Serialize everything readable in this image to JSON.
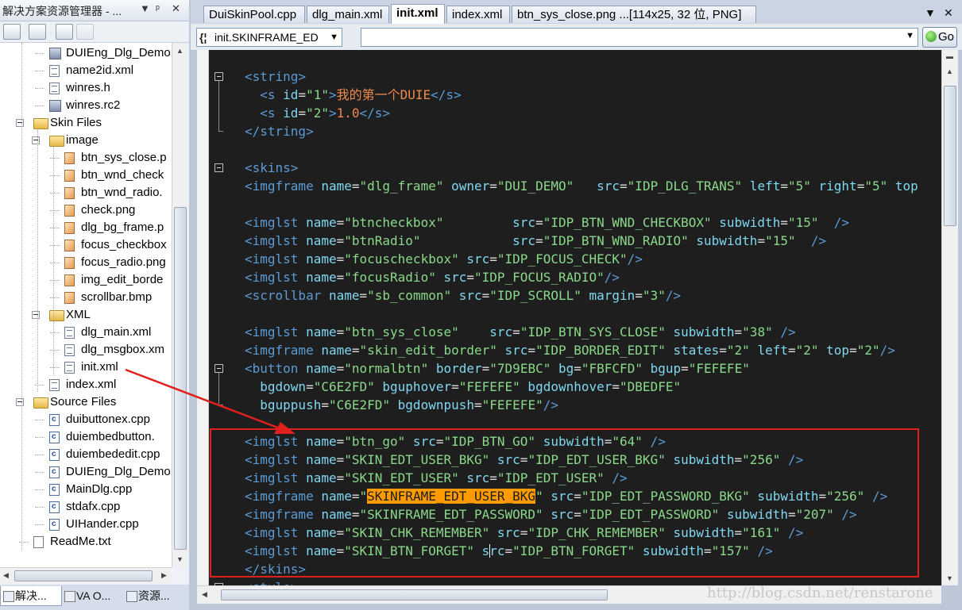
{
  "solution_explorer": {
    "title": "解决方案资源管理器 - ...",
    "title_buttons": [
      "▼",
      "ᵖ",
      "✕"
    ],
    "tree": [
      {
        "label": "DUIEng_Dlg_Demo",
        "icon": "rc",
        "level": 3
      },
      {
        "label": "name2id.xml",
        "icon": "file",
        "level": 3
      },
      {
        "label": "winres.h",
        "icon": "file",
        "level": 3
      },
      {
        "label": "winres.rc2",
        "icon": "rc",
        "level": 3
      },
      {
        "label": "Skin Files",
        "icon": "folder",
        "level": 2,
        "expandable": true
      },
      {
        "label": "image",
        "icon": "folder",
        "level": 3,
        "expandable": true
      },
      {
        "label": "btn_sys_close.p",
        "icon": "img",
        "level": 4
      },
      {
        "label": "btn_wnd_check",
        "icon": "img",
        "level": 4
      },
      {
        "label": "btn_wnd_radio.",
        "icon": "img",
        "level": 4
      },
      {
        "label": "check.png",
        "icon": "img",
        "level": 4
      },
      {
        "label": "dlg_bg_frame.p",
        "icon": "img",
        "level": 4
      },
      {
        "label": "focus_checkbox",
        "icon": "img",
        "level": 4
      },
      {
        "label": "focus_radio.png",
        "icon": "img",
        "level": 4
      },
      {
        "label": "img_edit_borde",
        "icon": "img",
        "level": 4
      },
      {
        "label": "scrollbar.bmp",
        "icon": "img",
        "level": 4
      },
      {
        "label": "XML",
        "icon": "folder",
        "level": 3,
        "expandable": true
      },
      {
        "label": "dlg_main.xml",
        "icon": "file",
        "level": 4
      },
      {
        "label": "dlg_msgbox.xm",
        "icon": "file",
        "level": 4
      },
      {
        "label": "init.xml",
        "icon": "file",
        "level": 4
      },
      {
        "label": "index.xml",
        "icon": "file",
        "level": 3
      },
      {
        "label": "Source Files",
        "icon": "folder",
        "level": 2,
        "expandable": true
      },
      {
        "label": "duibuttonex.cpp",
        "icon": "cpp",
        "level": 3
      },
      {
        "label": "duiembedbutton.",
        "icon": "cpp",
        "level": 3
      },
      {
        "label": "duiembededit.cpp",
        "icon": "cpp",
        "level": 3
      },
      {
        "label": "DUIEng_Dlg_Demo",
        "icon": "cpp",
        "level": 3
      },
      {
        "label": "MainDlg.cpp",
        "icon": "cpp",
        "level": 3
      },
      {
        "label": "stdafx.cpp",
        "icon": "cpp",
        "level": 3
      },
      {
        "label": "UIHander.cpp",
        "icon": "cpp",
        "level": 3
      },
      {
        "label": "ReadMe.txt",
        "icon": "txt",
        "level": 2
      }
    ],
    "bottom_tabs": [
      "解决...",
      "VA O...",
      "资源..."
    ]
  },
  "editor": {
    "tabs": [
      {
        "label": "DuiSkinPool.cpp",
        "active": false
      },
      {
        "label": "dlg_main.xml",
        "active": false
      },
      {
        "label": "init.xml",
        "active": true
      },
      {
        "label": "index.xml",
        "active": false
      },
      {
        "label": "btn_sys_close.png ...[114x25, 32 位, PNG]",
        "active": false
      }
    ],
    "tab_controls": [
      "▼",
      "✕"
    ],
    "nav_combo": {
      "prefix": "{¦",
      "value": "init.SKINFRAME_ED"
    },
    "go_button": "Go",
    "watermark": "http://blog.csdn.net/renstarone",
    "code_lines": [
      {
        "fold": "open",
        "parts": [
          [
            "tg",
            "<string>"
          ]
        ]
      },
      {
        "parts": [
          [
            "pn",
            "  "
          ],
          [
            "tg",
            "<s "
          ],
          [
            "at",
            "id"
          ],
          [
            "pn",
            "="
          ],
          [
            "vl",
            "\"1\""
          ],
          [
            "tg",
            ">"
          ],
          [
            "ch",
            "我的第一个DUIE"
          ],
          [
            "tg",
            "</s>"
          ]
        ]
      },
      {
        "parts": [
          [
            "pn",
            "  "
          ],
          [
            "tg",
            "<s "
          ],
          [
            "at",
            "id"
          ],
          [
            "pn",
            "="
          ],
          [
            "vl",
            "\"2\""
          ],
          [
            "tg",
            ">"
          ],
          [
            "ch",
            "1.0"
          ],
          [
            "tg",
            "</s>"
          ]
        ]
      },
      {
        "fold": "end",
        "parts": [
          [
            "tg",
            "</string>"
          ]
        ]
      },
      {
        "parts": []
      },
      {
        "fold": "open",
        "parts": [
          [
            "tg",
            "<skins>"
          ]
        ]
      },
      {
        "parts": [
          [
            "tg",
            "<imgframe "
          ],
          [
            "at",
            "name"
          ],
          [
            "pn",
            "="
          ],
          [
            "vl",
            "\"dlg_frame\""
          ],
          [
            "at",
            " owner"
          ],
          [
            "pn",
            "="
          ],
          [
            "vl",
            "\"DUI_DEMO\""
          ],
          [
            "at",
            "   src"
          ],
          [
            "pn",
            "="
          ],
          [
            "vl",
            "\"IDP_DLG_TRANS\""
          ],
          [
            "at",
            " left"
          ],
          [
            "pn",
            "="
          ],
          [
            "vl",
            "\"5\""
          ],
          [
            "at",
            " right"
          ],
          [
            "pn",
            "="
          ],
          [
            "vl",
            "\"5\""
          ],
          [
            "at",
            " top"
          ]
        ]
      },
      {
        "parts": []
      },
      {
        "parts": [
          [
            "tg",
            "<imglst "
          ],
          [
            "at",
            "name"
          ],
          [
            "pn",
            "="
          ],
          [
            "vl",
            "\"btncheckbox\""
          ],
          [
            "at",
            "         src"
          ],
          [
            "pn",
            "="
          ],
          [
            "vl",
            "\"IDP_BTN_WND_CHECKBOX\""
          ],
          [
            "at",
            " subwidth"
          ],
          [
            "pn",
            "="
          ],
          [
            "vl",
            "\"15\""
          ],
          [
            "tg",
            "  />"
          ]
        ]
      },
      {
        "parts": [
          [
            "tg",
            "<imglst "
          ],
          [
            "at",
            "name"
          ],
          [
            "pn",
            "="
          ],
          [
            "vl",
            "\"btnRadio\""
          ],
          [
            "at",
            "            src"
          ],
          [
            "pn",
            "="
          ],
          [
            "vl",
            "\"IDP_BTN_WND_RADIO\""
          ],
          [
            "at",
            " subwidth"
          ],
          [
            "pn",
            "="
          ],
          [
            "vl",
            "\"15\""
          ],
          [
            "tg",
            "  />"
          ]
        ]
      },
      {
        "parts": [
          [
            "tg",
            "<imglst "
          ],
          [
            "at",
            "name"
          ],
          [
            "pn",
            "="
          ],
          [
            "vl",
            "\"focuscheckbox\""
          ],
          [
            "at",
            " src"
          ],
          [
            "pn",
            "="
          ],
          [
            "vl",
            "\"IDP_FOCUS_CHECK\""
          ],
          [
            "tg",
            "/>"
          ]
        ]
      },
      {
        "parts": [
          [
            "tg",
            "<imglst "
          ],
          [
            "at",
            "name"
          ],
          [
            "pn",
            "="
          ],
          [
            "vl",
            "\"focusRadio\""
          ],
          [
            "at",
            " src"
          ],
          [
            "pn",
            "="
          ],
          [
            "vl",
            "\"IDP_FOCUS_RADIO\""
          ],
          [
            "tg",
            "/>"
          ]
        ]
      },
      {
        "parts": [
          [
            "tg",
            "<scrollbar "
          ],
          [
            "at",
            "name"
          ],
          [
            "pn",
            "="
          ],
          [
            "vl",
            "\"sb_common\""
          ],
          [
            "at",
            " src"
          ],
          [
            "pn",
            "="
          ],
          [
            "vl",
            "\"IDP_SCROLL\""
          ],
          [
            "at",
            " margin"
          ],
          [
            "pn",
            "="
          ],
          [
            "vl",
            "\"3\""
          ],
          [
            "tg",
            "/>"
          ]
        ]
      },
      {
        "parts": []
      },
      {
        "parts": [
          [
            "tg",
            "<imglst "
          ],
          [
            "at",
            "name"
          ],
          [
            "pn",
            "="
          ],
          [
            "vl",
            "\"btn_sys_close\""
          ],
          [
            "at",
            "    src"
          ],
          [
            "pn",
            "="
          ],
          [
            "vl",
            "\"IDP_BTN_SYS_CLOSE\""
          ],
          [
            "at",
            " subwidth"
          ],
          [
            "pn",
            "="
          ],
          [
            "vl",
            "\"38\""
          ],
          [
            "tg",
            " />"
          ]
        ]
      },
      {
        "parts": [
          [
            "tg",
            "<imgframe "
          ],
          [
            "at",
            "name"
          ],
          [
            "pn",
            "="
          ],
          [
            "vl",
            "\"skin_edit_border\""
          ],
          [
            "at",
            " src"
          ],
          [
            "pn",
            "="
          ],
          [
            "vl",
            "\"IDP_BORDER_EDIT\""
          ],
          [
            "at",
            " states"
          ],
          [
            "pn",
            "="
          ],
          [
            "vl",
            "\"2\""
          ],
          [
            "at",
            " left"
          ],
          [
            "pn",
            "="
          ],
          [
            "vl",
            "\"2\""
          ],
          [
            "at",
            " top"
          ],
          [
            "pn",
            "="
          ],
          [
            "vl",
            "\"2\""
          ],
          [
            "tg",
            "/>"
          ]
        ]
      },
      {
        "fold": "open",
        "parts": [
          [
            "tg",
            "<button "
          ],
          [
            "at",
            "name"
          ],
          [
            "pn",
            "="
          ],
          [
            "vl",
            "\"normalbtn\""
          ],
          [
            "at",
            " border"
          ],
          [
            "pn",
            "="
          ],
          [
            "vl",
            "\"7D9EBC\""
          ],
          [
            "at",
            " bg"
          ],
          [
            "pn",
            "="
          ],
          [
            "vl",
            "\"FBFCFD\""
          ],
          [
            "at",
            " bgup"
          ],
          [
            "pn",
            "="
          ],
          [
            "vl",
            "\"FEFEFE\""
          ]
        ]
      },
      {
        "parts": [
          [
            "at",
            "  bgdown"
          ],
          [
            "pn",
            "="
          ],
          [
            "vl",
            "\"C6E2FD\""
          ],
          [
            "at",
            " bguphover"
          ],
          [
            "pn",
            "="
          ],
          [
            "vl",
            "\"FEFEFE\""
          ],
          [
            "at",
            " bgdownhover"
          ],
          [
            "pn",
            "="
          ],
          [
            "vl",
            "\"DBEDFE\""
          ]
        ]
      },
      {
        "fold": "end",
        "parts": [
          [
            "at",
            "  bguppush"
          ],
          [
            "pn",
            "="
          ],
          [
            "vl",
            "\"C6E2FD\""
          ],
          [
            "at",
            " bgdownpush"
          ],
          [
            "pn",
            "="
          ],
          [
            "vl",
            "\"FEFEFE\""
          ],
          [
            "tg",
            "/>"
          ]
        ]
      },
      {
        "parts": []
      },
      {
        "parts": [
          [
            "tg",
            "<imglst "
          ],
          [
            "at",
            "name"
          ],
          [
            "pn",
            "="
          ],
          [
            "vl",
            "\"btn_go\""
          ],
          [
            "at",
            " src"
          ],
          [
            "pn",
            "="
          ],
          [
            "vl",
            "\"IDP_BTN_GO\""
          ],
          [
            "at",
            " subwidth"
          ],
          [
            "pn",
            "="
          ],
          [
            "vl",
            "\"64\""
          ],
          [
            "tg",
            " />"
          ]
        ]
      },
      {
        "parts": [
          [
            "tg",
            "<imglst "
          ],
          [
            "at",
            "name"
          ],
          [
            "pn",
            "="
          ],
          [
            "vl",
            "\"SKIN_EDT_USER_BKG\""
          ],
          [
            "at",
            " src"
          ],
          [
            "pn",
            "="
          ],
          [
            "vl",
            "\"IDP_EDT_USER_BKG\""
          ],
          [
            "at",
            " subwidth"
          ],
          [
            "pn",
            "="
          ],
          [
            "vl",
            "\"256\""
          ],
          [
            "tg",
            " />"
          ]
        ]
      },
      {
        "parts": [
          [
            "tg",
            "<imglst "
          ],
          [
            "at",
            "name"
          ],
          [
            "pn",
            "="
          ],
          [
            "vl",
            "\"SKIN_EDT_USER\""
          ],
          [
            "at",
            " src"
          ],
          [
            "pn",
            "="
          ],
          [
            "vl",
            "\"IDP_EDT_USER\""
          ],
          [
            "tg",
            " />"
          ]
        ]
      },
      {
        "parts": [
          [
            "tg",
            "<imgframe "
          ],
          [
            "at",
            "name"
          ],
          [
            "pn",
            "="
          ],
          [
            "vl",
            "\""
          ],
          [
            "hl",
            "SKINFRAME_EDT_USER_BKG"
          ],
          [
            "vl",
            "\""
          ],
          [
            "at",
            " src"
          ],
          [
            "pn",
            "="
          ],
          [
            "vl",
            "\"IDP_EDT_PASSWORD_BKG\""
          ],
          [
            "at",
            " subwidth"
          ],
          [
            "pn",
            "="
          ],
          [
            "vl",
            "\"256\""
          ],
          [
            "tg",
            " />"
          ]
        ]
      },
      {
        "parts": [
          [
            "tg",
            "<imgframe "
          ],
          [
            "at",
            "name"
          ],
          [
            "pn",
            "="
          ],
          [
            "vl",
            "\"SKINFRAME_EDT_PASSWORD\""
          ],
          [
            "at",
            " src"
          ],
          [
            "pn",
            "="
          ],
          [
            "vl",
            "\"IDP_EDT_PASSWORD\""
          ],
          [
            "at",
            " subwidth"
          ],
          [
            "pn",
            "="
          ],
          [
            "vl",
            "\"207\""
          ],
          [
            "tg",
            " />"
          ]
        ]
      },
      {
        "parts": [
          [
            "tg",
            "<imglst "
          ],
          [
            "at",
            "name"
          ],
          [
            "pn",
            "="
          ],
          [
            "vl",
            "\"SKIN_CHK_REMEMBER\""
          ],
          [
            "at",
            " src"
          ],
          [
            "pn",
            "="
          ],
          [
            "vl",
            "\"IDP_CHK_REMEMBER\""
          ],
          [
            "at",
            " subwidth"
          ],
          [
            "pn",
            "="
          ],
          [
            "vl",
            "\"161\""
          ],
          [
            "tg",
            " />"
          ]
        ]
      },
      {
        "parts": [
          [
            "tg",
            "<imglst "
          ],
          [
            "at",
            "name"
          ],
          [
            "pn",
            "="
          ],
          [
            "vl",
            "\"SKIN_BTN_FORGET\""
          ],
          [
            "at",
            " s"
          ],
          [
            "cur",
            ""
          ],
          [
            "at",
            "rc"
          ],
          [
            "pn",
            "="
          ],
          [
            "vl",
            "\"IDP_BTN_FORGET\""
          ],
          [
            "at",
            " subwidth"
          ],
          [
            "pn",
            "="
          ],
          [
            "vl",
            "\"157\""
          ],
          [
            "tg",
            " />"
          ]
        ]
      },
      {
        "fold": "end",
        "parts": [
          [
            "tg",
            "</skins>"
          ]
        ]
      },
      {
        "fold": "open",
        "parts": [
          [
            "tg",
            "<style>"
          ]
        ]
      }
    ]
  },
  "colors": {
    "editor_bg": "#1e1e1e",
    "tag": "#5b9bd5",
    "attribute": "#7fd7f0",
    "value": "#8ad88a",
    "highlight": "#ff9b00",
    "annotation": "#e0201e"
  }
}
